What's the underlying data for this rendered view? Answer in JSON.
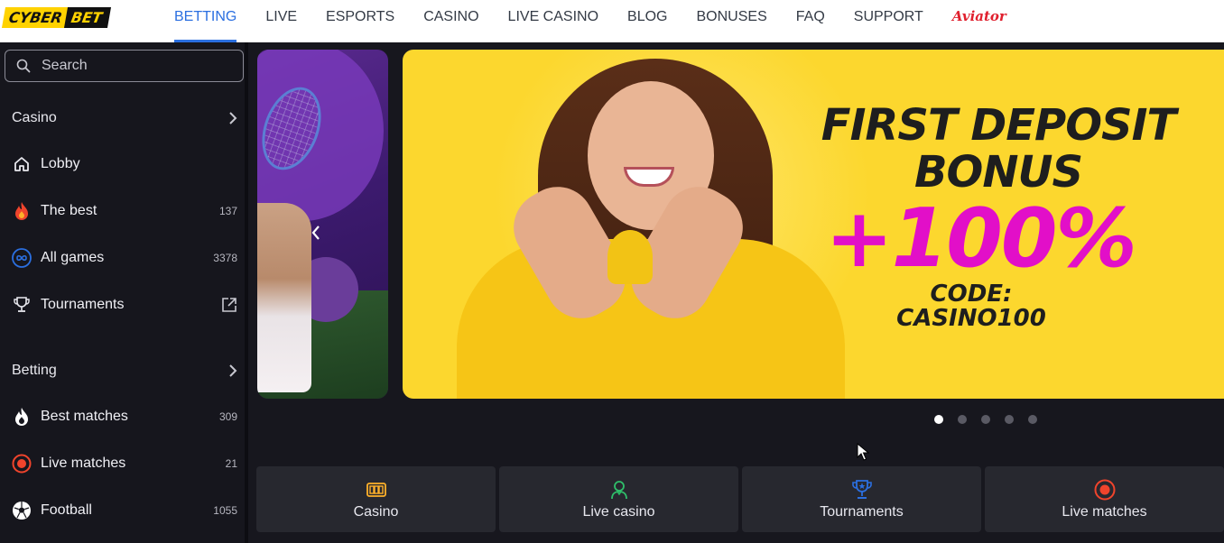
{
  "brand": {
    "part1": "CYBER",
    "part2": "BET"
  },
  "nav": {
    "items": [
      "BETTING",
      "LIVE",
      "ESPORTS",
      "CASINO",
      "LIVE CASINO",
      "BLOG",
      "BONUSES",
      "FAQ",
      "SUPPORT"
    ],
    "aviator": "Aviator",
    "active": "BETTING"
  },
  "sidebar": {
    "search_placeholder": "Search",
    "casino": {
      "heading": "Casino",
      "items": [
        {
          "label": "Lobby",
          "icon": "home-icon",
          "count": ""
        },
        {
          "label": "The best",
          "icon": "fire-icon",
          "count": "137"
        },
        {
          "label": "All games",
          "icon": "infinity-icon",
          "count": "3378"
        },
        {
          "label": "Tournaments",
          "icon": "trophy-icon",
          "count": ""
        }
      ]
    },
    "betting": {
      "heading": "Betting",
      "items": [
        {
          "label": "Best matches",
          "icon": "fire-icon",
          "count": "309"
        },
        {
          "label": "Live matches",
          "icon": "live-dot-icon",
          "count": "21"
        },
        {
          "label": "Football",
          "icon": "football-icon",
          "count": "1055"
        }
      ]
    }
  },
  "banner": {
    "line1": "FIRST DEPOSIT",
    "line2": "BONUS",
    "big": "+100%",
    "code_label": "CODE:",
    "code_value": "CASINO100",
    "dots_total": 5,
    "dots_active": 1
  },
  "tiles": [
    {
      "label": "Casino",
      "icon": "slot-machine-icon"
    },
    {
      "label": "Live casino",
      "icon": "dealer-icon"
    },
    {
      "label": "Tournaments",
      "icon": "trophy-icon"
    },
    {
      "label": "Live matches",
      "icon": "live-dot-icon"
    }
  ],
  "colors": {
    "accent": "#2b6fe0",
    "banner_bg": "#fcd72e",
    "promo_magenta": "#e20fc8",
    "aviator_red": "#e0202e",
    "sidebar_bg": "#16161d",
    "tile_bg": "#27282f"
  }
}
